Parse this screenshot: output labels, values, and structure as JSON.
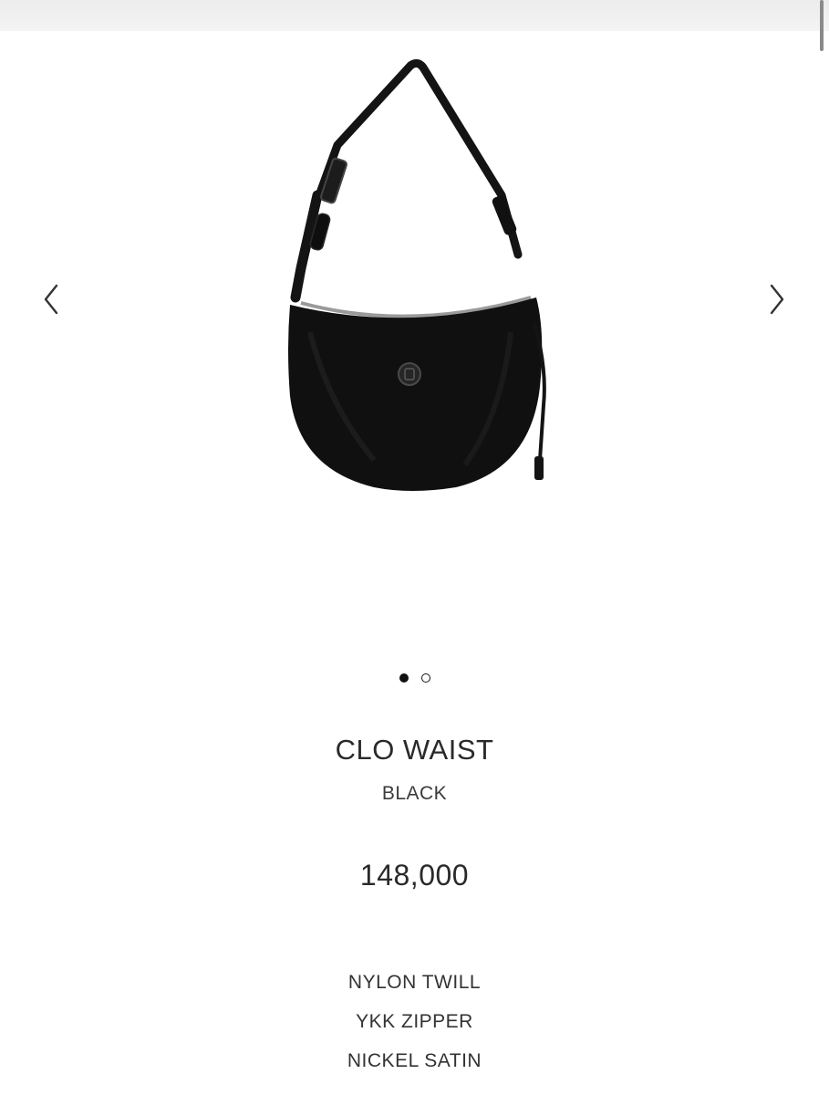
{
  "product": {
    "name": "CLO WAIST",
    "color": "BLACK",
    "price": "148,000",
    "materials": [
      "NYLON TWILL",
      "YKK ZIPPER",
      "NICKEL SATIN"
    ]
  },
  "carousel": {
    "total_slides": 2,
    "active_slide": 1,
    "prev_icon": "chevron-left-icon",
    "next_icon": "chevron-right-icon"
  },
  "colors": {
    "background": "#ffffff",
    "text": "#2b2b2b",
    "bag": "#101010"
  }
}
